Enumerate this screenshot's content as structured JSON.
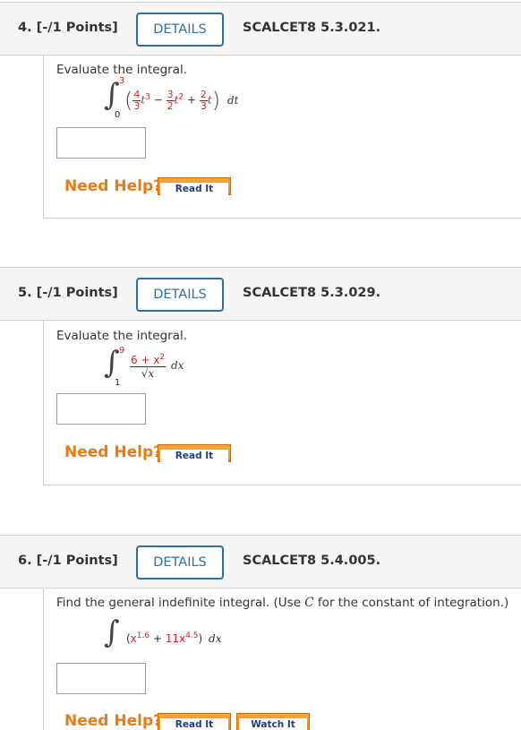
{
  "questions": [
    {
      "number": "4. [-/1 Points]",
      "details_label": "DETAILS",
      "ref": "SCALCET8 5.3.021.",
      "prompt": "Evaluate the integral.",
      "integral": {
        "lower": "0",
        "upper": "3",
        "c1_num": "4",
        "c1_den": "3",
        "p1": "3",
        "c2_num": "3",
        "c2_den": "2",
        "p2": "2",
        "c3_num": "2",
        "c3_den": "3",
        "var": "t",
        "diff": "dt"
      },
      "help_label": "Need Help?",
      "buttons": [
        "Read It"
      ]
    },
    {
      "number": "5. [-/1 Points]",
      "details_label": "DETAILS",
      "ref": "SCALCET8 5.3.029.",
      "prompt": "Evaluate the integral.",
      "integral": {
        "lower": "1",
        "upper": "9",
        "num": "6 + x",
        "num_exp": "2",
        "den": "√x",
        "diff": "dx"
      },
      "help_label": "Need Help?",
      "buttons": [
        "Read It"
      ]
    },
    {
      "number": "6. [-/1 Points]",
      "details_label": "DETAILS",
      "ref": "SCALCET8 5.4.005.",
      "prompt_before": "Find the general indefinite integral. (Use ",
      "prompt_var": "C",
      "prompt_after": " for the constant of integration.)",
      "integral": {
        "b1": "x",
        "e1": "1.6",
        "plus": " + ",
        "coef": "11",
        "b2": "x",
        "e2": "4.5",
        "diff": "dx"
      },
      "help_label": "Need Help?",
      "buttons": [
        "Read It",
        "Watch It"
      ]
    }
  ]
}
